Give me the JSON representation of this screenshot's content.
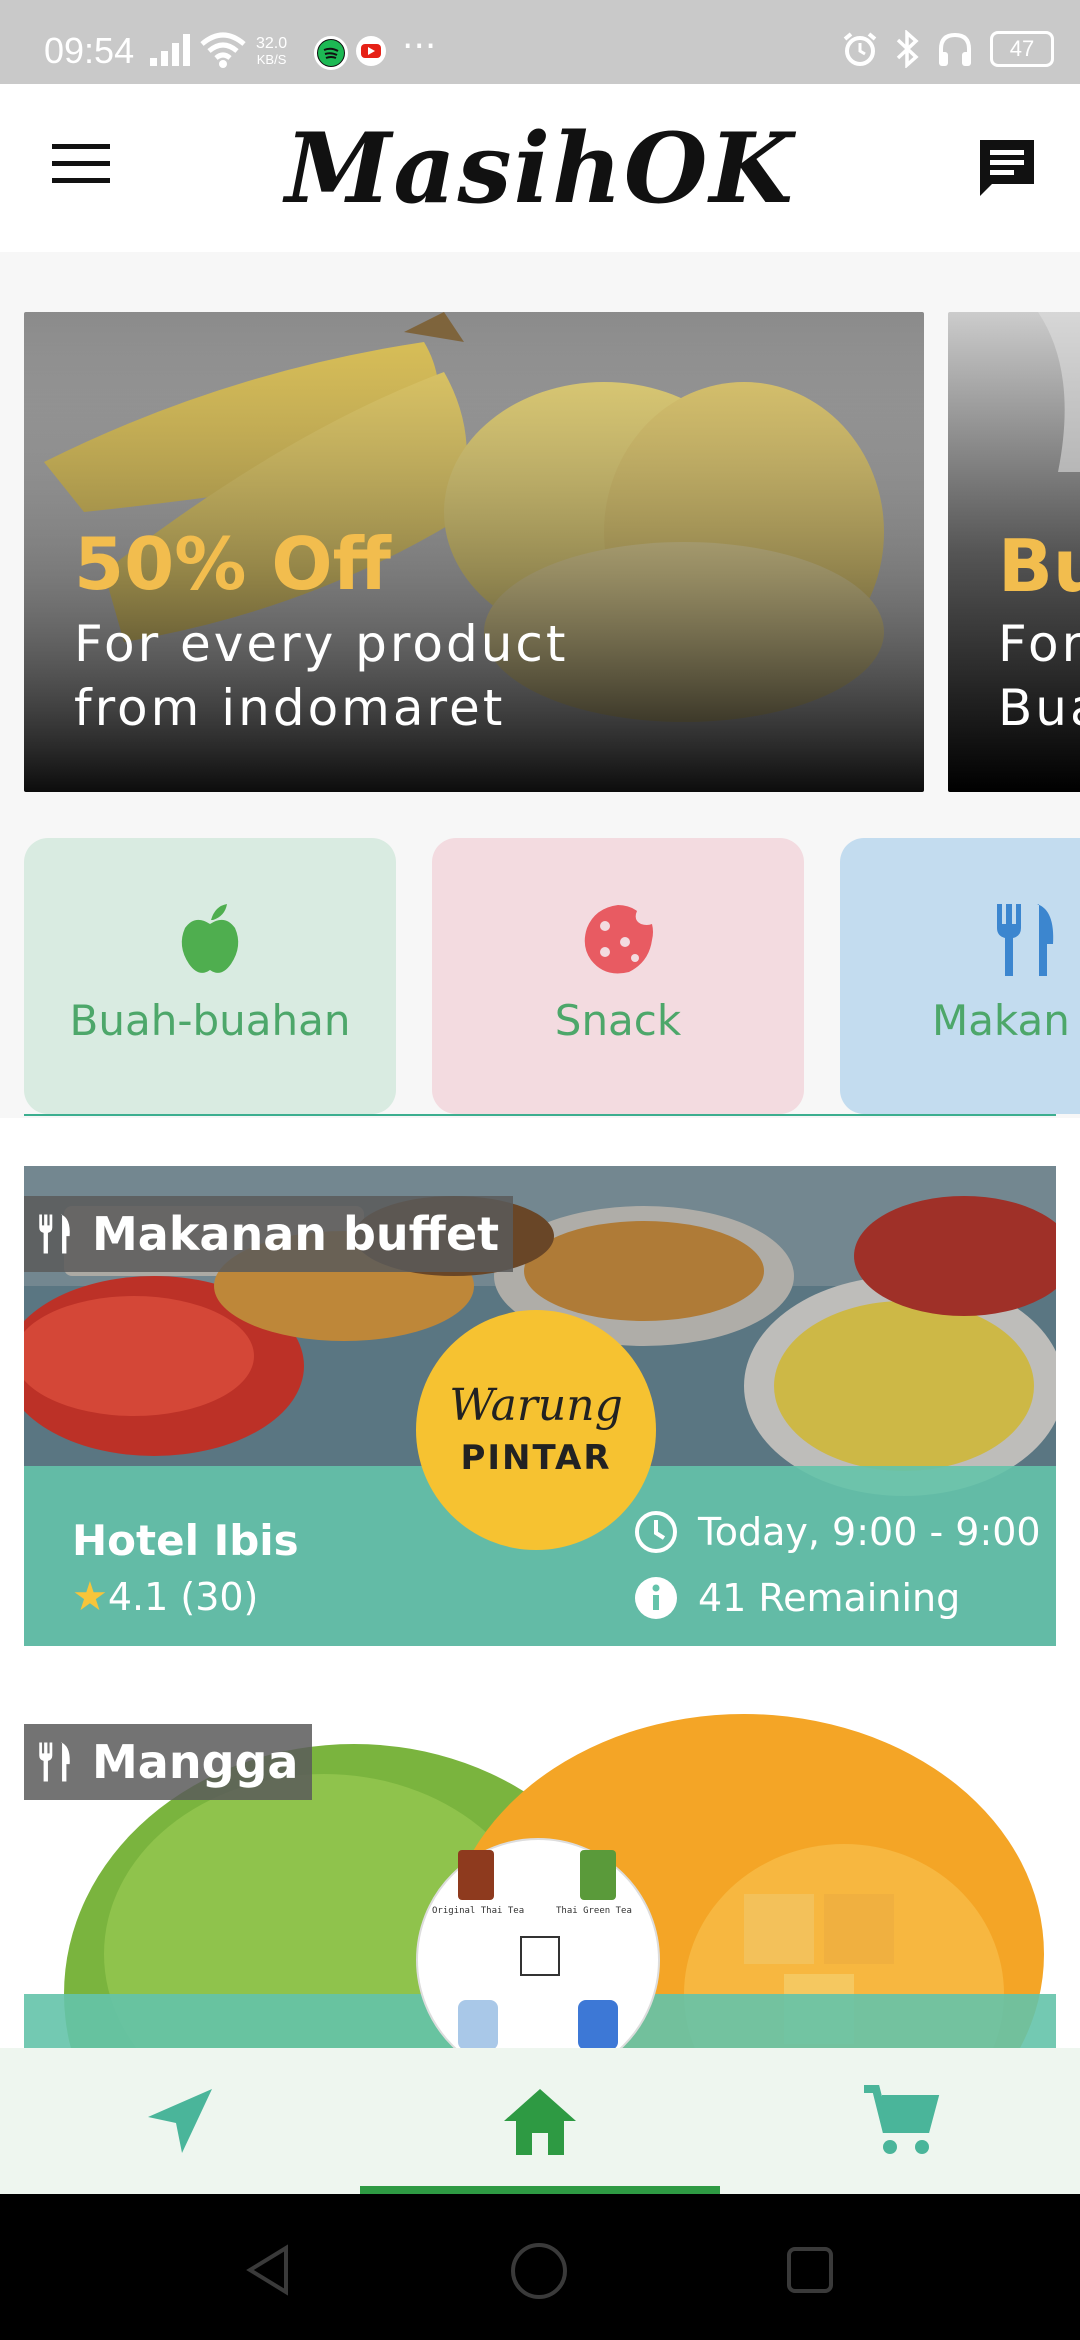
{
  "status_bar": {
    "time": "09:54",
    "net_speed_value": "32.0",
    "net_speed_unit": "KB/S",
    "battery": "47"
  },
  "app_bar": {
    "title": "MasihOK"
  },
  "banners": [
    {
      "title": "50% Off",
      "subtitle": "For every product from indomaret"
    },
    {
      "title": "Bu",
      "subtitle": "For Bua"
    }
  ],
  "categories": [
    {
      "label": "Buah-buahan",
      "icon": "apple-icon",
      "bg": "#d9ebe1"
    },
    {
      "label": "Snack",
      "icon": "cookie-icon",
      "bg": "#f3dbe0"
    },
    {
      "label": "Makan B",
      "icon": "cutlery-icon",
      "bg": "#c3dcef"
    }
  ],
  "cards": [
    {
      "tag": "Makanan buffet",
      "name": "Hotel Ibis",
      "rating": "4.1 (30)",
      "time": "Today,  9:00 - 9:00",
      "remaining": "41 Remaining",
      "logo_line1": "Warung",
      "logo_line2": "PINTAR"
    },
    {
      "tag": "Mangga",
      "logo_text_1": "Original Thai Tea",
      "logo_text_2": "Thai Green Tea"
    }
  ],
  "colors": {
    "accent": "#2e9a43",
    "banner_title": "#f2bd4e",
    "card_overlay": "#64c3aa",
    "category_text": "#4da76a"
  },
  "bottom_nav": [
    "navigation-icon",
    "home-icon",
    "cart-icon"
  ]
}
